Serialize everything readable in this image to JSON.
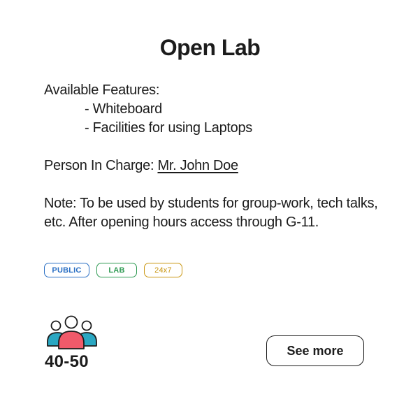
{
  "card": {
    "title": "Open Lab",
    "features_label": "Available Features:",
    "features": [
      "- Whiteboard",
      "- Facilities for using Laptops"
    ],
    "person_label": "Person In Charge: ",
    "person_name": "Mr. John Doe",
    "note": "Note: To be used by students for group-work, tech talks, etc. After opening hours access through G-11.",
    "tags": [
      "PUBLIC",
      "LAB",
      "24x7"
    ],
    "capacity": "40-50",
    "see_more_label": "See more",
    "icon": "people-group-icon",
    "colors": {
      "tag_public": "#2a6fc4",
      "tag_lab": "#2e9a52",
      "tag_24x7": "#c9950f",
      "person_center": "#f05a6a",
      "person_side": "#2aa7c2"
    }
  }
}
